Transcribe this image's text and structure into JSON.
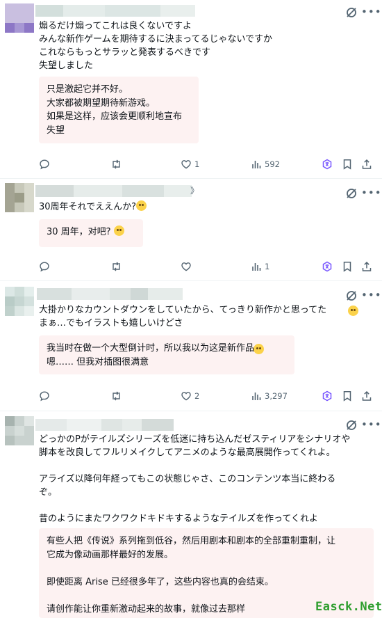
{
  "posts": [
    {
      "text": "煽るだけ煽ってこれは良くないですよ\nみんな新作ゲームを期待するに決まってるじゃないですか\nこれならもっとサラッと発表するべきです\n失望しました",
      "translation": "只是激起它并不好。\n大家都被期望期待新游戏。\n如果是这样，应该会更顺利地宣布\n失望",
      "replies": "",
      "reposts": "",
      "likes": "1",
      "views": "592"
    },
    {
      "handle_suffix": "》",
      "text": "30周年それでええんか?",
      "translation": "30 周年，对吧?",
      "replies": "",
      "reposts": "",
      "likes": "",
      "views": "1"
    },
    {
      "text": "大掛かりなカウントダウンをしていたから、てっきり新作かと思ってた\nまぁ…でもイラストも嬉しいけどさ",
      "translation": "我当时在做一个大型倒计时，所以我以为这是新作品\n嗯…… 但我对插图很满意",
      "replies": "",
      "reposts": "",
      "likes": "2",
      "views": "3,297"
    },
    {
      "text": "どっかのPがテイルズシリーズを低迷に持ち込んだゼスティリアをシナリオや\n脚本を改良してフルリメイクしてアニメのような最高展開作ってくれよ。\n\nアライズ以降何年経ってもこの状態じゃさ、このコンテンツ本当に終わる\nぞ。\n\n昔のようにまたワクワクドキドキするようなテイルズを作ってくれよ",
      "translation": "有些人把《传说》系列拖到低谷，然后用剧本和剧本的全部重制重制，让\n它成为像动画那样最好的发展。\n\n即使距离 Arise 已经很多年了，这些内容也真的会结束。\n\n请创作能让你重新激动起来的故事，就像过去那样"
    }
  ],
  "icons": [
    "grok-icon",
    "more-icon",
    "reply-icon",
    "repost-icon",
    "like-icon",
    "views-icon",
    "translate-icon",
    "bookmark-icon",
    "share-icon"
  ],
  "colors": {
    "accent": "#7856ff",
    "icon": "#536471",
    "translation_bg": "#fdf2f2",
    "watermark": "#2e9e2e"
  },
  "watermark": "Easck.Net"
}
